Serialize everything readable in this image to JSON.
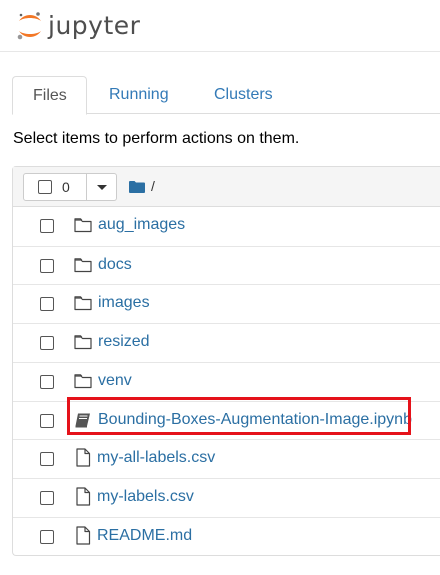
{
  "header": {
    "logo_text": "jupyter"
  },
  "tabs": [
    {
      "label": "Files"
    },
    {
      "label": "Running"
    },
    {
      "label": "Clusters"
    }
  ],
  "instruction": "Select items to perform actions on them.",
  "toolbar": {
    "selected_count": "0",
    "breadcrumb_root": "/"
  },
  "files": [
    {
      "name": "aug_images",
      "type": "folder"
    },
    {
      "name": "docs",
      "type": "folder"
    },
    {
      "name": "images",
      "type": "folder"
    },
    {
      "name": "resized",
      "type": "folder"
    },
    {
      "name": "venv",
      "type": "folder"
    },
    {
      "name": "Bounding-Boxes-Augmentation-Image.ipynb",
      "type": "notebook",
      "highlighted": true
    },
    {
      "name": "my-all-labels.csv",
      "type": "file"
    },
    {
      "name": "my-labels.csv",
      "type": "file"
    },
    {
      "name": "README.md",
      "type": "file"
    }
  ],
  "colors": {
    "link": "#2b6fa3",
    "highlight": "#e5121a",
    "logo_orange": "#f37726"
  }
}
